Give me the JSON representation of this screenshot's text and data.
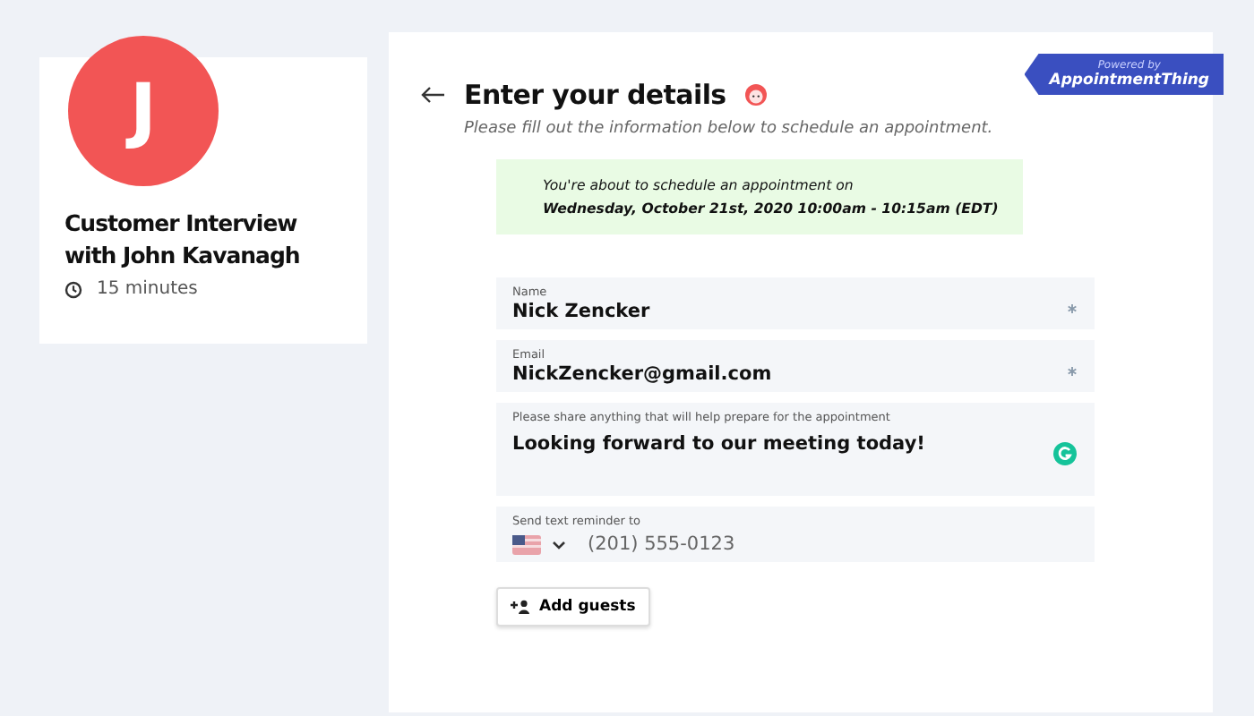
{
  "event": {
    "initial": "J",
    "title": "Customer Interview with John Kavanagh",
    "duration": "15 minutes"
  },
  "badge": {
    "caption": "Powered by",
    "brand": "AppointmentThing"
  },
  "header": {
    "title": "Enter your details",
    "subtitle": "Please fill out the information below to schedule an appointment."
  },
  "notice": {
    "line_1": "You're about to schedule an appointment on",
    "line_2": "Wednesday, October 21st, 2020 10:00am - 10:15am (EDT)"
  },
  "fields": [
    {
      "kind": "text",
      "label": "Name",
      "value": "Nick Zencker",
      "required": true
    },
    {
      "kind": "text",
      "label": "Email",
      "value": "NickZencker@gmail.com",
      "required": true
    },
    {
      "kind": "textarea",
      "label": "Please share anything that will help prepare for the appointment",
      "value": "Looking forward to our meeting today!",
      "required": false
    },
    {
      "kind": "phone",
      "label": "Send text reminder to",
      "placeholder": "(201) 555-0123",
      "required": false
    }
  ],
  "add_guests": "Add guests"
}
